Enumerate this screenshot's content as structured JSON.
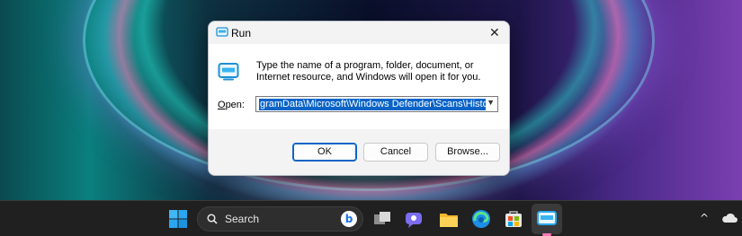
{
  "dialog": {
    "title": "Run",
    "close_glyph": "✕",
    "description": "Type the name of a program, folder, document, or Internet resource, and Windows will open it for you.",
    "open_label_underlined": "O",
    "open_label_rest": "pen:",
    "open_value": "gramData\\Microsoft\\Windows Defender\\Scans\\History",
    "ok_label": "OK",
    "cancel_label": "Cancel",
    "browse_label": "Browse..."
  },
  "taskbar": {
    "search_placeholder": "Search",
    "bing_glyph": "b",
    "tray_arrow": "^",
    "apps": [
      "start-icon",
      "task-view-icon",
      "teams-chat-icon",
      "file-explorer-icon",
      "edge-icon",
      "store-icon",
      "run-icon"
    ]
  },
  "colors": {
    "accent": "#0a64c8",
    "taskbar": "#202020",
    "active_indicator": "#ff7ab8"
  }
}
